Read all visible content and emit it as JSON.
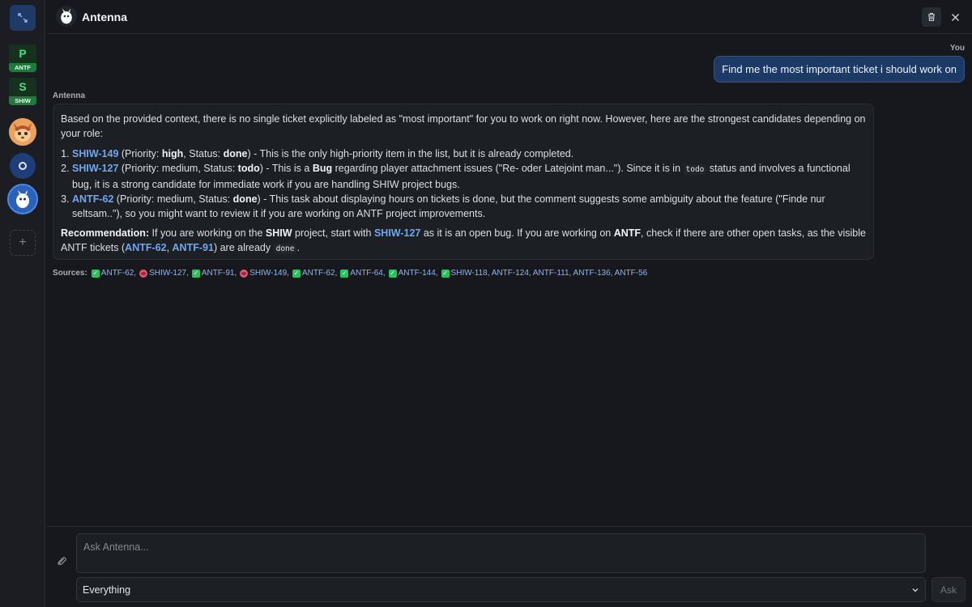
{
  "header": {
    "title": "Antenna"
  },
  "sidebar": {
    "projects": [
      {
        "letter": "P",
        "tag": "ANTF"
      },
      {
        "letter": "S",
        "tag": "SHIW"
      }
    ],
    "add_label": "+"
  },
  "chat": {
    "user_label": "You",
    "user_message": "Find me the most important ticket i should work on",
    "bot_label": "Antenna",
    "intro": "Based on the provided context, there is no single ticket explicitly labeled as \"most important\" for you to work on right now. However, here are the strongest candidates depending on your role:",
    "items": [
      {
        "ticket": "SHIW-149",
        "p1": " (Priority: ",
        "priority": "high",
        "p2": ", Status: ",
        "status": "done",
        "rest": ") - This is the only high-priority item in the list, but it is already completed."
      },
      {
        "ticket": "SHIW-127",
        "p1": " (Priority: medium, Status: ",
        "status": "todo",
        "p2": ") - This is a ",
        "kind": "Bug",
        "p3": " regarding player attachment issues (\"Re- oder Latejoint man...\"). Since it is in ",
        "code": "todo",
        "rest": " status and involves a functional bug, it is a strong candidate for immediate work if you are handling SHIW project bugs."
      },
      {
        "ticket": "ANTF-62",
        "p1": " (Priority: medium, Status: ",
        "status": "done",
        "rest": ") - This task about displaying hours on tickets is done, but the comment suggests some ambiguity about the feature (\"Finde nur seltsam..\"), so you might want to review it if you are working on ANTF project improvements."
      }
    ],
    "recommendation": {
      "label": "Recommendation:",
      "t1": " If you are working on the ",
      "proj1": "SHIW",
      "t2": " project, start with ",
      "ticket1": "SHIW-127",
      "t3": " as it is an open bug. If you are working on ",
      "proj2": "ANTF",
      "t4": ", check if there are other open tasks, as the visible ANTF tickets (",
      "ticket2": "ANTF-62",
      "sep": ", ",
      "ticket3": "ANTF-91",
      "t5": ") are already ",
      "code": "done",
      "end": "."
    },
    "sources_label": "Sources:",
    "sources": [
      {
        "icon": "check",
        "id": "ANTF-62,"
      },
      {
        "icon": "bug",
        "id": "SHIW-127,"
      },
      {
        "icon": "check",
        "id": "ANTF-91,"
      },
      {
        "icon": "bug",
        "id": "SHIW-149,"
      },
      {
        "icon": "check",
        "id": "ANTF-62,"
      },
      {
        "icon": "check",
        "id": "ANTF-64,"
      },
      {
        "icon": "check",
        "id": "ANTF-144,"
      },
      {
        "icon": "check",
        "id": "SHIW-118, ANTF-124, ANTF-111, ANTF-136, ANTF-56"
      }
    ]
  },
  "footer": {
    "placeholder": "Ask Antenna...",
    "scope": "Everything",
    "ask_label": "Ask"
  }
}
